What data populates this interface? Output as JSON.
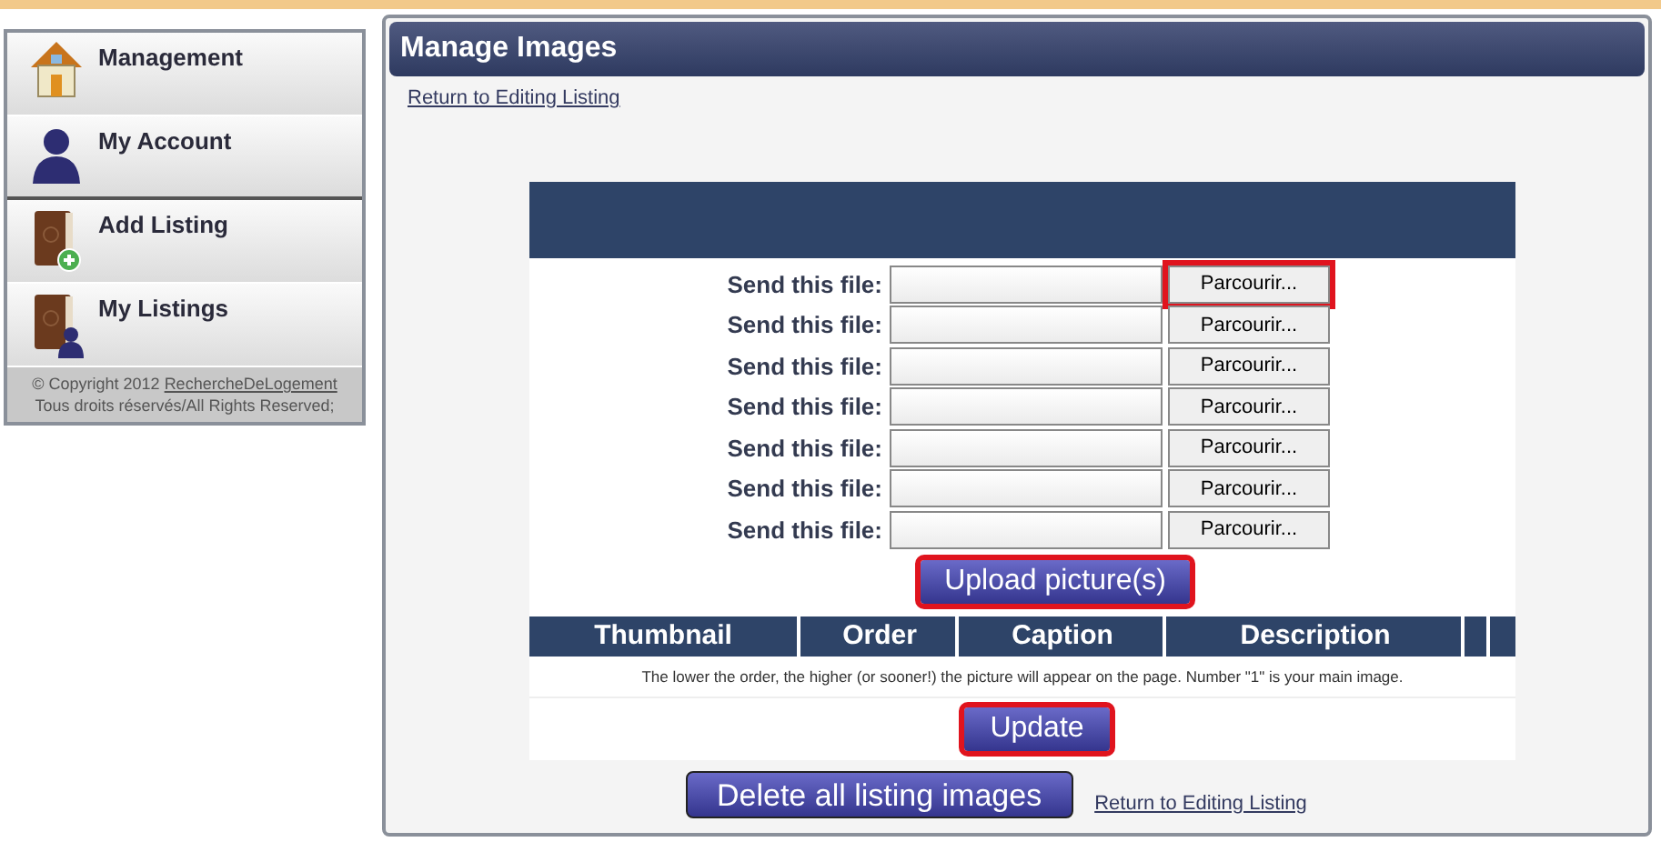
{
  "sidebar": {
    "items": [
      {
        "label": "Management",
        "kind": "house"
      },
      {
        "label": "My Account",
        "kind": "person"
      },
      {
        "label": "Add Listing",
        "kind": "book-add"
      },
      {
        "label": "My Listings",
        "kind": "book-person"
      }
    ],
    "footer": {
      "prefix": "© Copyright 2012 ",
      "link": "RechercheDeLogement",
      "rights": "Tous droits réservés/All Rights Reserved;"
    }
  },
  "panel": {
    "title": "Manage Images",
    "top_link": "Return to Editing Listing",
    "upload_rows": [
      {
        "label": "Send this file:",
        "button": "Parcourir...",
        "highlighted": true
      },
      {
        "label": "Send this file:",
        "button": "Parcourir...",
        "highlighted": false
      },
      {
        "label": "Send this file:",
        "button": "Parcourir...",
        "highlighted": false
      },
      {
        "label": "Send this file:",
        "button": "Parcourir...",
        "highlighted": false
      },
      {
        "label": "Send this file:",
        "button": "Parcourir...",
        "highlighted": false
      },
      {
        "label": "Send this file:",
        "button": "Parcourir...",
        "highlighted": false
      },
      {
        "label": "Send this file:",
        "button": "Parcourir...",
        "highlighted": false
      }
    ],
    "upload_button": {
      "label": "Upload picture(s)",
      "highlighted": true
    },
    "table": {
      "columns": [
        "Thumbnail",
        "Order",
        "Caption",
        "Description"
      ],
      "note": "The lower the order, the higher (or sooner!) the picture will appear on the page. Number \"1\" is your main image."
    },
    "update_button": {
      "label": "Update",
      "highlighted": true
    },
    "delete_button": {
      "label": "Delete all listing images",
      "highlighted": false
    },
    "bottom_link": "Return to Editing Listing"
  }
}
